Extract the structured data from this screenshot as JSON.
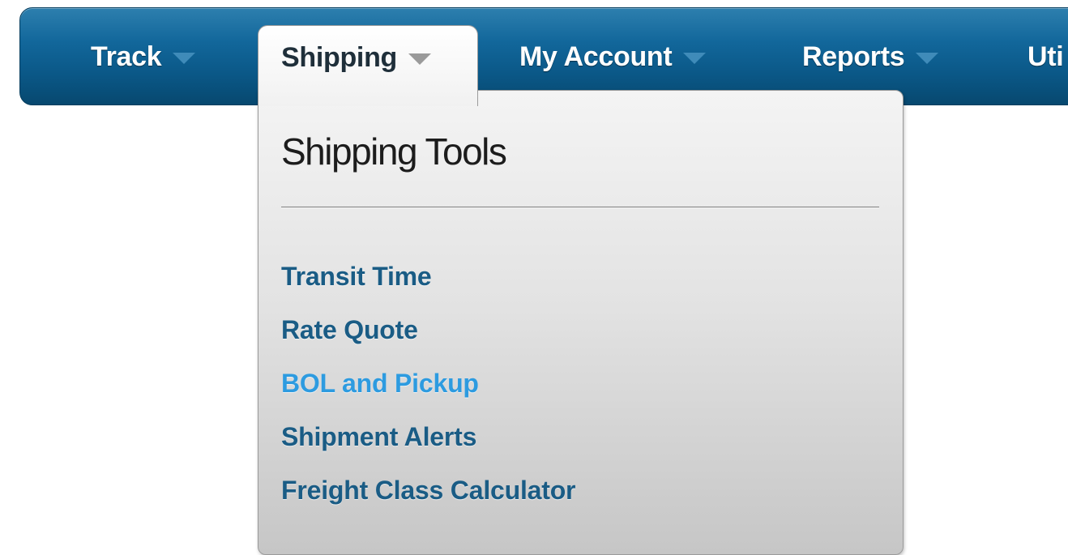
{
  "nav": {
    "track_label": "Track",
    "shipping_label": "Shipping",
    "account_label": "My Account",
    "reports_label": "Reports",
    "utilities_label": "Uti"
  },
  "dropdown": {
    "title": "Shipping Tools",
    "items": [
      {
        "label": "Transit Time"
      },
      {
        "label": "Rate Quote"
      },
      {
        "label": "BOL and Pickup"
      },
      {
        "label": "Shipment Alerts"
      },
      {
        "label": "Freight Class Calculator"
      }
    ],
    "hovered_item": "BOL and Pickup"
  },
  "colors": {
    "nav_bar": "#0a5786",
    "link": "#1a5c85",
    "link_hover": "#2d9be0"
  },
  "icons": {
    "nav_caret": "chevron-down-icon"
  }
}
